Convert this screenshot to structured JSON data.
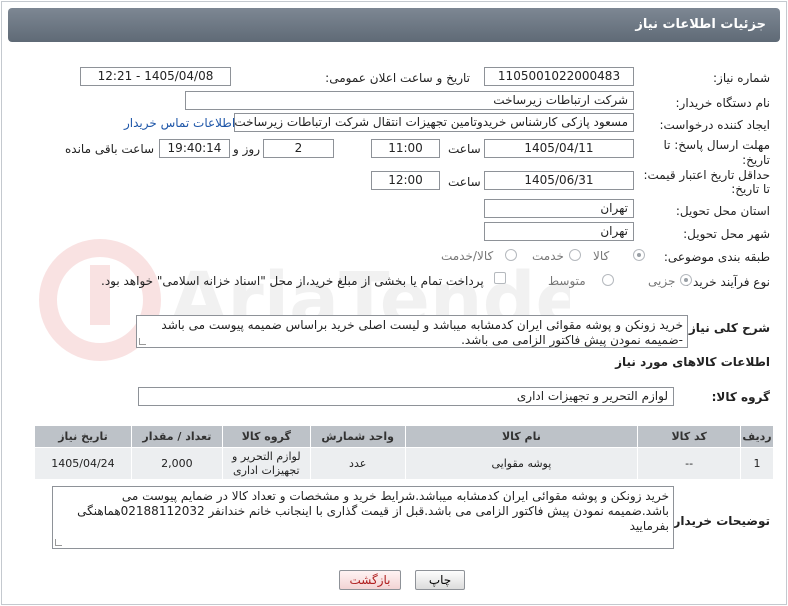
{
  "header": {
    "title": "جزئیات اطلاعات نیاز"
  },
  "fields": {
    "need_number_label": "شماره نیاز:",
    "need_number": "1105001022000483",
    "announce_label": "تاریخ و ساعت اعلان عمومی:",
    "announce_value": "1405/04/08 - 12:21",
    "buyer_org_label": "نام دستگاه خریدار:",
    "buyer_org": "شرکت ارتباطات زیرساخت",
    "creator_label": "ایجاد کننده درخواست:",
    "creator": "مسعود پازکی کارشناس خریدوتامین تجهیزات انتقال شرکت ارتباطات زیرساخت",
    "contact_link": "اطلاعات تماس خریدار",
    "deadline_label_1": "مهلت ارسال پاسخ: تا",
    "deadline_label_2": "تاریخ:",
    "deadline_date": "1405/04/11",
    "time_label": "ساعت",
    "deadline_time": "11:00",
    "days_value": "2",
    "days_label": "روز و",
    "remaining_time": "19:40:14",
    "remaining_label": "ساعت باقی مانده",
    "validity_label_1": "حداقل تاریخ اعتبار قیمت:",
    "validity_label_2": "تا تاریخ:",
    "validity_date": "1405/06/31",
    "validity_time": "12:00",
    "province_label": "استان محل تحویل:",
    "province": "تهران",
    "city_label": "شهر محل تحویل:",
    "city": "تهران",
    "category_label": "طبقه بندی موضوعی:",
    "category_options": [
      "کالا",
      "خدمت",
      "کالا/خدمت"
    ],
    "process_label": "نوع فرآیند خرید :",
    "process_options": [
      "جزیی",
      "متوسط"
    ],
    "payment_note": "پرداخت تمام یا بخشی از مبلغ خرید،از محل \"اسناد خزانه اسلامی\" خواهد بود.",
    "summary_label": "شرح کلی نیاز:",
    "summary_text": "خرید زونکن و پوشه مقوائی ایران کدمشابه میباشد و لیست اصلی خرید براساس ضمیمه پیوست می باشد -ضمیمه نمودن پیش فاکتور الزامی می باشد.",
    "goods_info_title": "اطلاعات کالاهای مورد نیاز",
    "goods_group_label": "گروه کالا:",
    "goods_group": "لوازم التحریر و تجهیزات اداری"
  },
  "table": {
    "columns": [
      "ردیف",
      "کد کالا",
      "نام کالا",
      "واحد شمارش",
      "گروه کالا",
      "تعداد / مقدار",
      "تاریخ نیاز"
    ],
    "rows": [
      [
        "1",
        "--",
        "پوشه مقوایی",
        "عدد",
        "لوازم التحریر و تجهیزات اداری",
        "2,000",
        "1405/04/24"
      ]
    ]
  },
  "buyer_notes": {
    "label": "توضیحات خریدار:",
    "text": "خرید زونکن و پوشه مقوائی ایران کدمشابه میباشد.شرایط خرید و مشخصات و تعداد کالا در ضمایم پیوست می باشد.ضمیمه نمودن پیش فاکتور الزامی می باشد.قبل از قیمت گذاری با اینجانب خانم خندانفر 02188112032هماهنگی بفرمایید"
  },
  "buttons": {
    "print": "چاپ",
    "back": "بازگشت"
  },
  "colors": {
    "header": "#6a7480",
    "table_header": "#bdc2c8",
    "link": "#1e56a8",
    "back_text": "#b02020"
  }
}
